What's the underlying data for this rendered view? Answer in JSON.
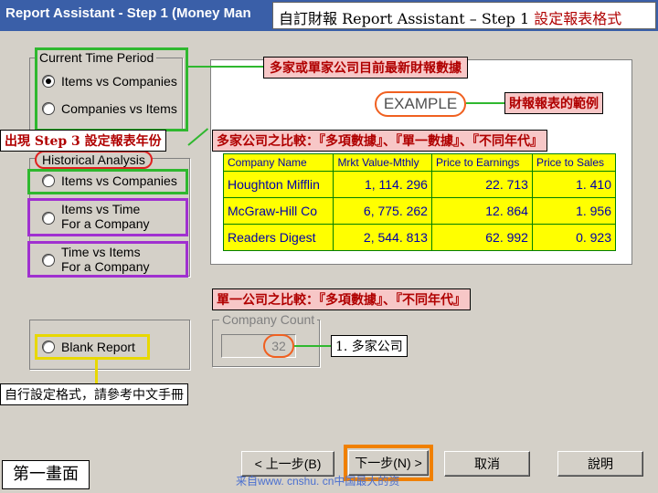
{
  "window": {
    "title": "Report Assistant - Step 1  (Money Man",
    "overlay_title_prefix": "自訂財報 Report Assistant – Step 1 ",
    "overlay_title_suffix": "設定報表格式"
  },
  "current_time_period": {
    "label": "Current Time Period",
    "options": [
      "Items vs Companies",
      "Companies vs Items"
    ],
    "selected": "Items vs Companies"
  },
  "historical_analysis": {
    "label": "Historical Analysis",
    "options": [
      "Items vs Companies",
      "Items vs Time For a Company",
      "Time vs Items For a Company"
    ],
    "option_items_time_line1": "Items vs Time",
    "option_items_time_line2": "For a Company",
    "option_time_items_line1": "Time vs Items",
    "option_time_items_line2": "For a Company"
  },
  "blank_report": {
    "label": "Blank Report"
  },
  "company_count": {
    "label": "Company Count",
    "value": "32"
  },
  "example": {
    "label": "EXAMPLE",
    "caption": "財報報表的範例",
    "table": {
      "headers": [
        "Company Name",
        "Mrkt Value-Mthly",
        "Price to Earnings",
        "Price to Sales"
      ],
      "rows": [
        [
          "Houghton Mifflin",
          "1, 114. 296",
          "22. 713",
          "1. 410"
        ],
        [
          "McGraw-Hill Co",
          "6, 775. 262",
          "12. 864",
          "1. 956"
        ],
        [
          "Readers Digest",
          "2, 544. 813",
          "62. 992",
          "0. 923"
        ]
      ]
    }
  },
  "annotations": {
    "latest_data": "多家或單家公司目前最新財報數據",
    "step3": "出現 Step 3 設定報表年份",
    "multi_compare": "多家公司之比較：『多項數據』、『單一數據』、『不同年代』",
    "single_compare": "單一公司之比較：『多項數據』、『不同年代』",
    "multi_company": "1. 多家公司",
    "custom_format": "自行設定格式，請參考中文手冊",
    "first_screen": "第一畫面",
    "watermark": "来自www. cnshu. cn中国最大的资"
  },
  "buttons": {
    "back": "< 上一步(B)",
    "next": "下一步(N) >",
    "cancel": "取消",
    "help": "說明"
  },
  "colors": {
    "green": "#2fb82f",
    "purple": "#a030d0",
    "yellow": "#e8d800",
    "orange": "#f08000",
    "red_text": "#b00000"
  }
}
